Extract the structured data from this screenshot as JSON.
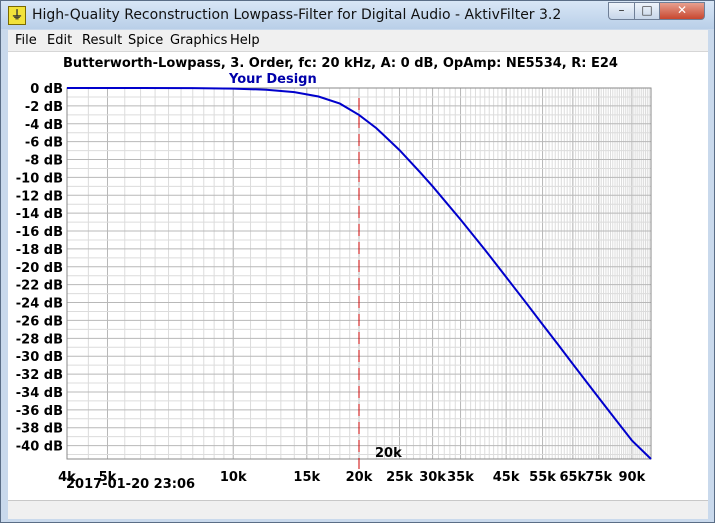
{
  "window": {
    "title": "High-Quality Reconstruction Lowpass-Filter for Digital Audio - AktivFilter 3.2",
    "icon": "filter-app-icon",
    "controls": {
      "minimize": "–",
      "maximize": "□",
      "close": "✕"
    }
  },
  "menu": [
    "File",
    "Edit",
    "Result",
    "Spice",
    "Graphics",
    "Help"
  ],
  "chart_data": {
    "type": "line",
    "title": "Butterworth-Lowpass, 3. Order, fc: 20 kHz, A: 0 dB, OpAmp: NE5534, R: E24",
    "subtitle": "Your Design",
    "x_scale": "log",
    "xlim": [
      4000,
      100000
    ],
    "ylim": [
      -41.5,
      0
    ],
    "x_ticks": [
      {
        "value": 4000,
        "label": "4k"
      },
      {
        "value": 5000,
        "label": "5k"
      },
      {
        "value": 10000,
        "label": "10k"
      },
      {
        "value": 15000,
        "label": "15k"
      },
      {
        "value": 20000,
        "label": "20k"
      },
      {
        "value": 25000,
        "label": "25k"
      },
      {
        "value": 30000,
        "label": "30k"
      },
      {
        "value": 35000,
        "label": "35k"
      },
      {
        "value": 45000,
        "label": "45k"
      },
      {
        "value": 55000,
        "label": "55k"
      },
      {
        "value": 65000,
        "label": "65k"
      },
      {
        "value": 75000,
        "label": "75k"
      },
      {
        "value": 90000,
        "label": "90k"
      }
    ],
    "y_ticks": [
      {
        "value": 0,
        "label": "0 dB"
      },
      {
        "value": -2,
        "label": "-2 dB"
      },
      {
        "value": -4,
        "label": "-4 dB"
      },
      {
        "value": -6,
        "label": "-6 dB"
      },
      {
        "value": -8,
        "label": "-8 dB"
      },
      {
        "value": -10,
        "label": "-10 dB"
      },
      {
        "value": -12,
        "label": "-12 dB"
      },
      {
        "value": -14,
        "label": "-14 dB"
      },
      {
        "value": -16,
        "label": "-16 dB"
      },
      {
        "value": -18,
        "label": "-18 dB"
      },
      {
        "value": -20,
        "label": "-20 dB"
      },
      {
        "value": -22,
        "label": "-22 dB"
      },
      {
        "value": -24,
        "label": "-24 dB"
      },
      {
        "value": -26,
        "label": "-26 dB"
      },
      {
        "value": -28,
        "label": "-28 dB"
      },
      {
        "value": -30,
        "label": "-30 dB"
      },
      {
        "value": -32,
        "label": "-32 dB"
      },
      {
        "value": -34,
        "label": "-34 dB"
      },
      {
        "value": -36,
        "label": "-36 dB"
      },
      {
        "value": -38,
        "label": "-38 dB"
      },
      {
        "value": -40,
        "label": "-40 dB"
      }
    ],
    "series": [
      {
        "color": "#0000cc",
        "x": [
          4000,
          5000,
          6000,
          8000,
          10000,
          12000,
          14000,
          16000,
          18000,
          20000,
          22000,
          25000,
          28000,
          30000,
          35000,
          40000,
          45000,
          50000,
          55000,
          60000,
          65000,
          70000,
          75000,
          80000,
          90000,
          100000
        ],
        "y": [
          0,
          0,
          0,
          -0.01,
          -0.07,
          -0.19,
          -0.46,
          -0.95,
          -1.75,
          -3.01,
          -4.48,
          -6.95,
          -9.42,
          -11.0,
          -14.71,
          -18.08,
          -21.14,
          -23.91,
          -26.44,
          -28.74,
          -30.87,
          -32.84,
          -34.66,
          -36.35,
          -39.43,
          -41.5
        ]
      }
    ],
    "cutoff_marker": {
      "x": 20000,
      "label": "20k",
      "color": "#cc0000"
    },
    "grid": true,
    "date_text": "2017-01-20 23:06"
  }
}
